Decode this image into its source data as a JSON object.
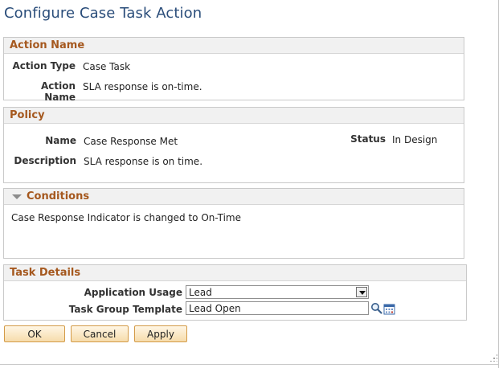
{
  "page": {
    "title": "Configure Case Task Action"
  },
  "action_name_section": {
    "title": "Action Name",
    "action_type_label": "Action Type",
    "action_type_value": "Case Task",
    "action_name_label": "Action Name",
    "action_name_value": "SLA response is on-time."
  },
  "policy_section": {
    "title": "Policy",
    "name_label": "Name",
    "name_value": "Case Response Met",
    "status_label": "Status",
    "status_value": "In Design",
    "description_label": "Description",
    "description_value": "SLA response is on time."
  },
  "conditions_section": {
    "title": "Conditions",
    "text": "Case Response Indicator is changed to On-Time"
  },
  "task_details_section": {
    "title": "Task Details",
    "application_usage_label": "Application Usage",
    "application_usage_value": "Lead",
    "task_group_template_label": "Task Group Template",
    "task_group_template_value": "Lead Open"
  },
  "buttons": {
    "ok": "OK",
    "cancel": "Cancel",
    "apply": "Apply"
  },
  "icons": {
    "lookup": "magnifier-icon",
    "calendar": "calendar-icon",
    "collapse": "triangle-down-icon"
  },
  "colors": {
    "title": "#2a4d7a",
    "section_title": "#a5581e",
    "button_border": "#d39a47"
  }
}
